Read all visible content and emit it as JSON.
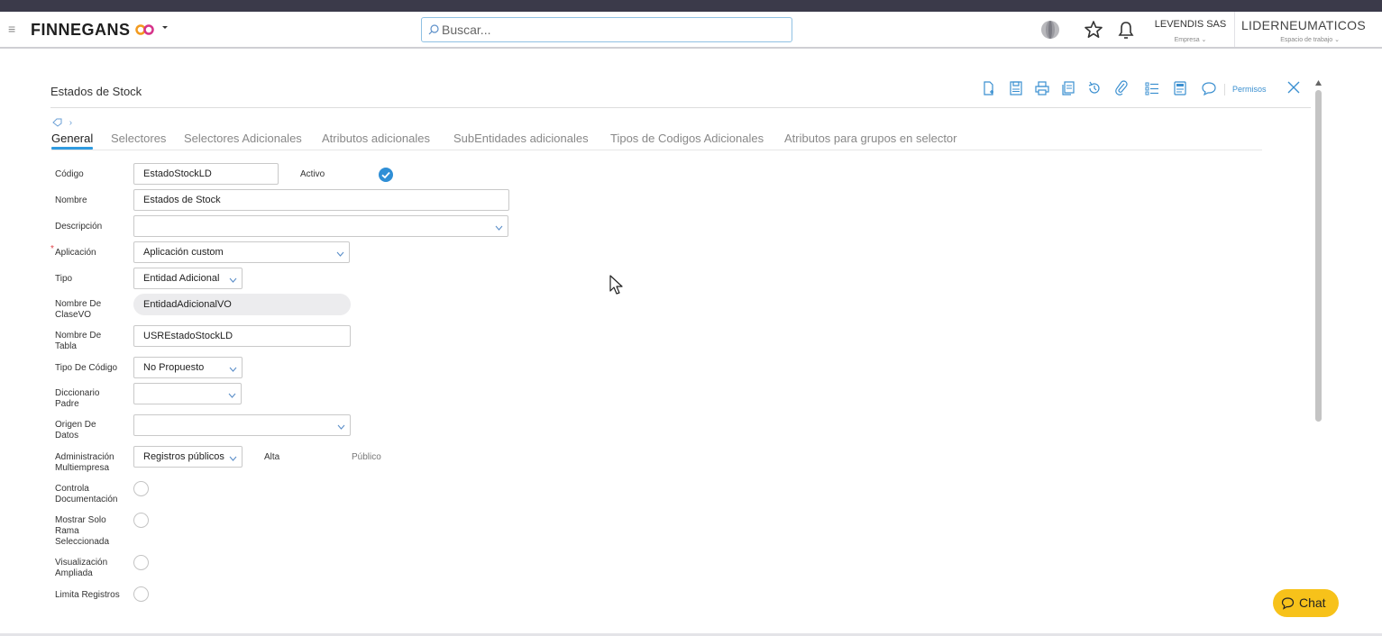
{
  "header": {
    "logo_text": "FINNEGANS",
    "search_placeholder": "Buscar...",
    "company": {
      "name": "LEVENDIS SAS",
      "label": "Empresa"
    },
    "workspace": {
      "name": "LIDERNEUMATICOS",
      "label": "Espacio de trabajo"
    }
  },
  "form": {
    "title": "Estados de Stock",
    "permisos_label": "Permisos",
    "tabs": [
      {
        "label": "General",
        "active": true
      },
      {
        "label": "Selectores"
      },
      {
        "label": "Selectores Adicionales"
      },
      {
        "label": "Atributos adicionales"
      },
      {
        "label": "SubEntidades adicionales"
      },
      {
        "label": "Tipos de Codigos Adicionales"
      },
      {
        "label": "Atributos para grupos en selector"
      }
    ],
    "fields": {
      "codigo": {
        "label": "Código",
        "value": "EstadoStockLD"
      },
      "activo": {
        "label": "Activo",
        "checked": true
      },
      "nombre": {
        "label": "Nombre",
        "value": "Estados de Stock"
      },
      "descripcion": {
        "label": "Descripción",
        "value": ""
      },
      "aplicacion": {
        "label": "Aplicación",
        "value": "Aplicación custom",
        "required": true
      },
      "tipo": {
        "label": "Tipo",
        "value": "Entidad Adicional"
      },
      "nombre_clasevo": {
        "label_line1": "Nombre De",
        "label_line2": "ClaseVO",
        "value": "EntidadAdicionalVO"
      },
      "nombre_tabla": {
        "label_line1": "Nombre De",
        "label_line2": "Tabla",
        "value": "USREstadoStockLD"
      },
      "tipo_codigo": {
        "label": "Tipo De Código",
        "value": "No Propuesto"
      },
      "diccionario_padre": {
        "label_line1": "Diccionario",
        "label_line2": "Padre",
        "value": ""
      },
      "origen_datos": {
        "label_line1": "Origen De",
        "label_line2": "Datos",
        "value": ""
      },
      "administracion": {
        "label_line1": "Administración",
        "label_line2": "Multiempresa",
        "value": "Registros públicos",
        "alta": "Alta",
        "publico": "Público"
      },
      "controla_documentacion": {
        "label_line1": "Controla",
        "label_line2": "Documentación",
        "checked": false
      },
      "mostrar_solo_rama": {
        "label_line1": "Mostrar Solo",
        "label_line2": "Rama",
        "label_line3": "Seleccionada",
        "checked": false
      },
      "visualizacion_ampliada": {
        "label_line1": "Visualización",
        "label_line2": "Ampliada",
        "checked": false
      },
      "limita_registros": {
        "label": "Limita Registros",
        "checked": false
      }
    }
  },
  "chat": {
    "label": "Chat"
  },
  "colors": {
    "accent": "#2f9be0",
    "topbar": "#3b3a4a",
    "chat": "#f7c21a",
    "required": "#e0454a"
  }
}
